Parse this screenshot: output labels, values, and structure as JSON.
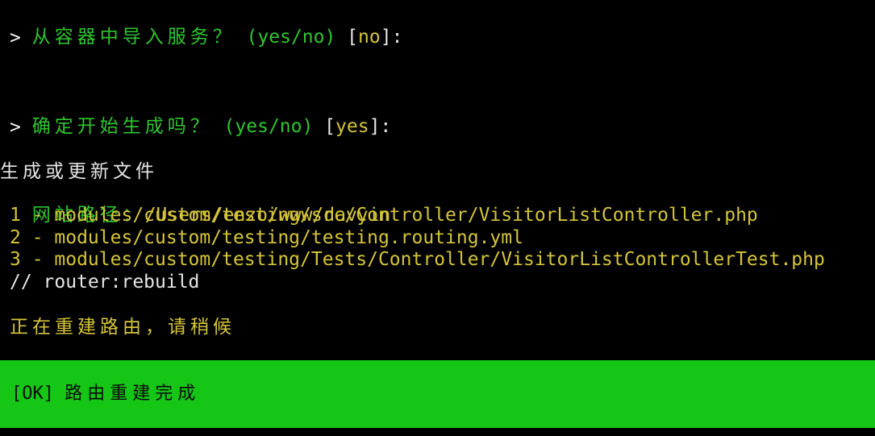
{
  "prompts": [
    {
      "question": "从容器中导入服务？",
      "options": " (yes/no)",
      "default_open": " [",
      "default_value": "no",
      "default_close": "]:",
      "cursor": ">"
    },
    {
      "question": "确定开始生成吗？",
      "options": " (yes/no)",
      "default_open": " [",
      "default_value": "yes",
      "default_close": "]:",
      "cursor": ">"
    }
  ],
  "generation": {
    "header": "生成或更新文件",
    "site_path_label": "网站路径：",
    "site_path_value": "/Users/enzo/www/davyin",
    "files": [
      "1 - modules/custom/testing/src/Controller/VisitorListController.php",
      "2 - modules/custom/testing/testing.routing.yml",
      "3 - modules/custom/testing/Tests/Controller/VisitorListControllerTest.php"
    ],
    "comment": "// router:rebuild",
    "rebuilding_message": "正在重建路由，请稍候"
  },
  "success": {
    "tag": "[OK]",
    "message": "路由重建完成"
  },
  "colors": {
    "background": "#000000",
    "prompt_green": "#2fc52f",
    "value_yellow": "#d4c43a",
    "text_white": "#e6e6e6",
    "success_bar": "#16c616"
  }
}
